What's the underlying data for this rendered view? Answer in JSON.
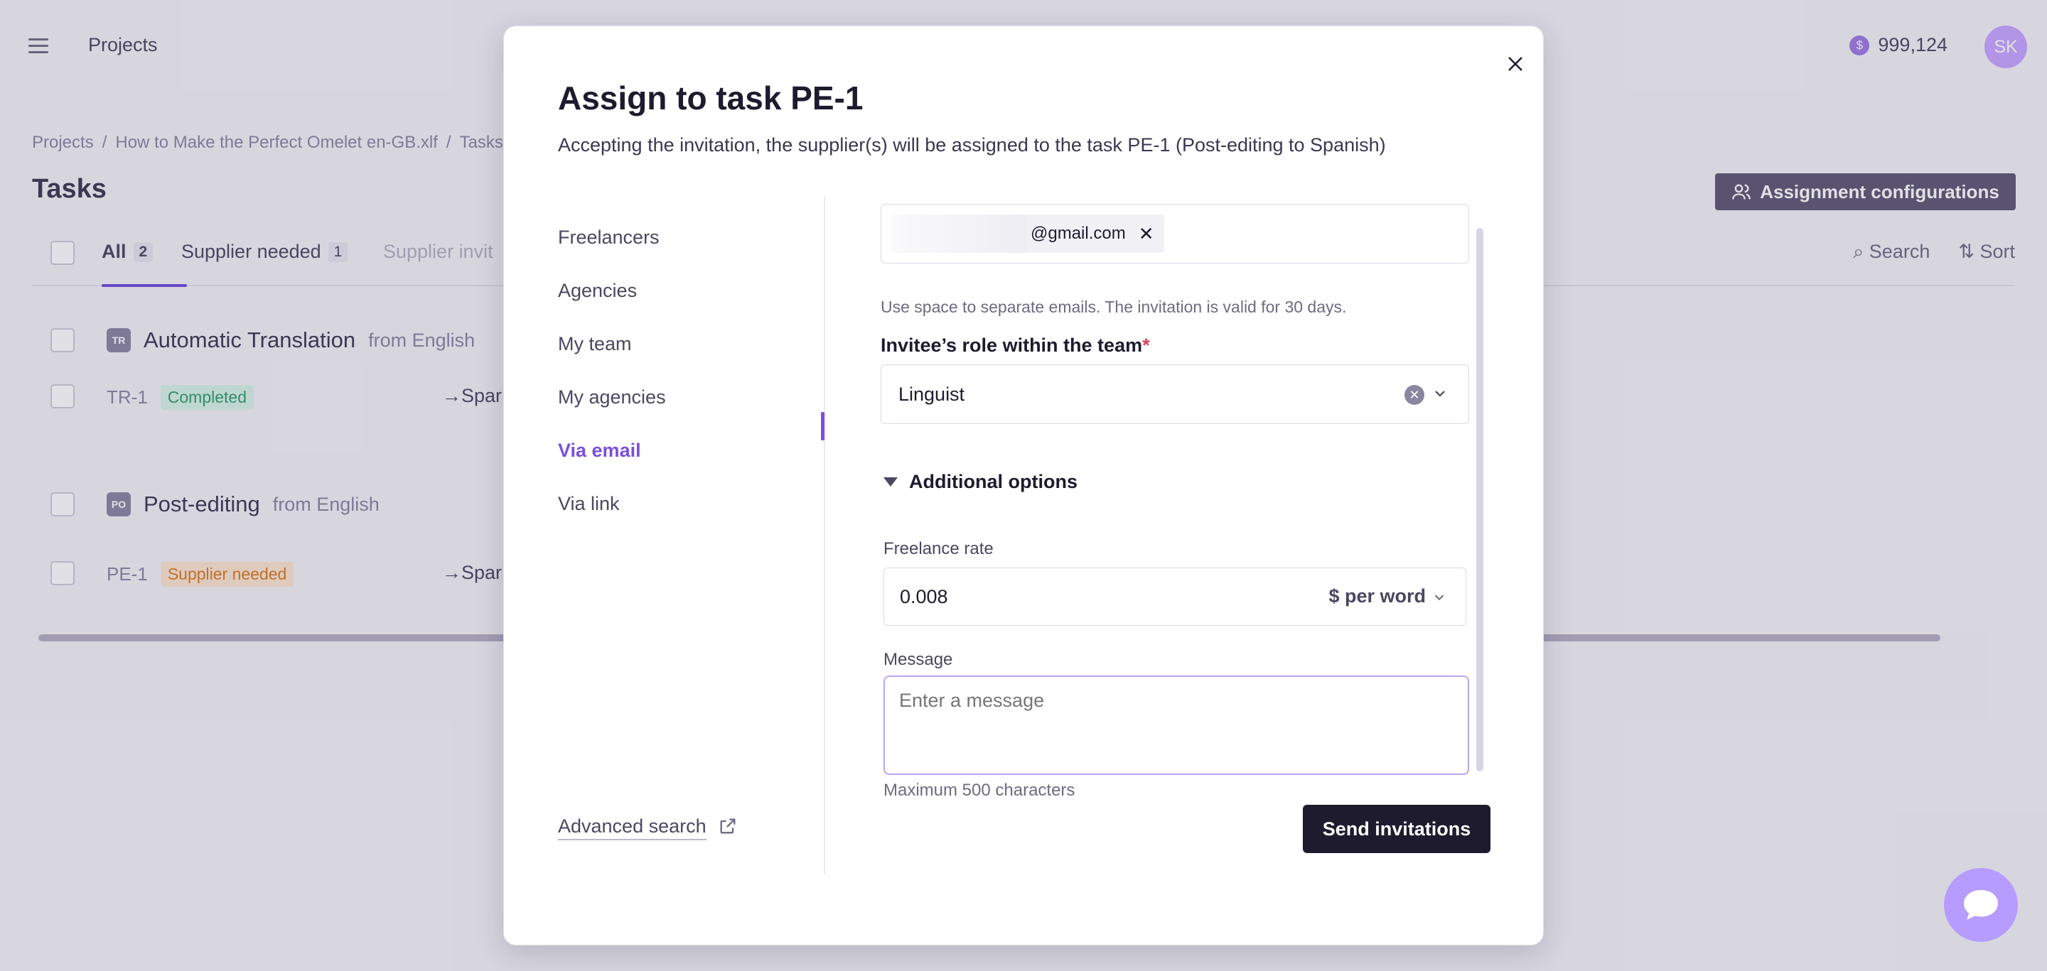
{
  "background": {
    "app_title": "Projects",
    "balance": "999,124",
    "coin_symbol": "$",
    "avatar_initials": "SK",
    "breadcrumb": [
      "Projects",
      "/",
      "How to Make the Perfect Omelet en-GB.xlf",
      "/",
      "Tasks"
    ],
    "page_title": "Tasks",
    "assignment_config_label": "Assignment configurations",
    "tabs": [
      {
        "label": "All",
        "count": "2"
      },
      {
        "label": "Supplier needed",
        "count": "1"
      },
      {
        "label": "Supplier invit"
      }
    ],
    "search_label": "Search",
    "sort_label": "Sort",
    "groups": [
      {
        "icon": "TR",
        "title": "Automatic Translation",
        "from": "from English",
        "task_id": "TR-1",
        "status": "Completed",
        "target": "Spar"
      },
      {
        "icon": "PO",
        "title": "Post-editing",
        "from": "from English",
        "task_id": "PE-1",
        "status": "Supplier needed",
        "target": "Spar"
      }
    ]
  },
  "modal": {
    "title": "Assign to task PE-1",
    "subtitle": "Accepting the invitation, the supplier(s) will be assigned to the task PE-1 (Post-editing to Spanish)",
    "nav": [
      "Freelancers",
      "Agencies",
      "My team",
      "My agencies",
      "Via email",
      "Via link"
    ],
    "active_nav": "Via email",
    "advanced_search": "Advanced search",
    "email_chip": "@gmail.com",
    "email_hint": "Use space to separate emails. The invitation is valid for 30 days.",
    "role_label": "Invitee’s role within the team",
    "required_mark": "*",
    "role_value": "Linguist",
    "additional_options": "Additional options",
    "freelance_rate_label": "Freelance rate",
    "freelance_rate_value": "0.008",
    "rate_unit": "$ per word",
    "message_label": "Message",
    "message_placeholder": "Enter a message",
    "max_chars": "Maximum 500 characters",
    "send_label": "Send invitations"
  },
  "colors": {
    "accent": "#7a4fe0",
    "primary_button": "#1e1b2e",
    "required": "#e43b5a"
  }
}
